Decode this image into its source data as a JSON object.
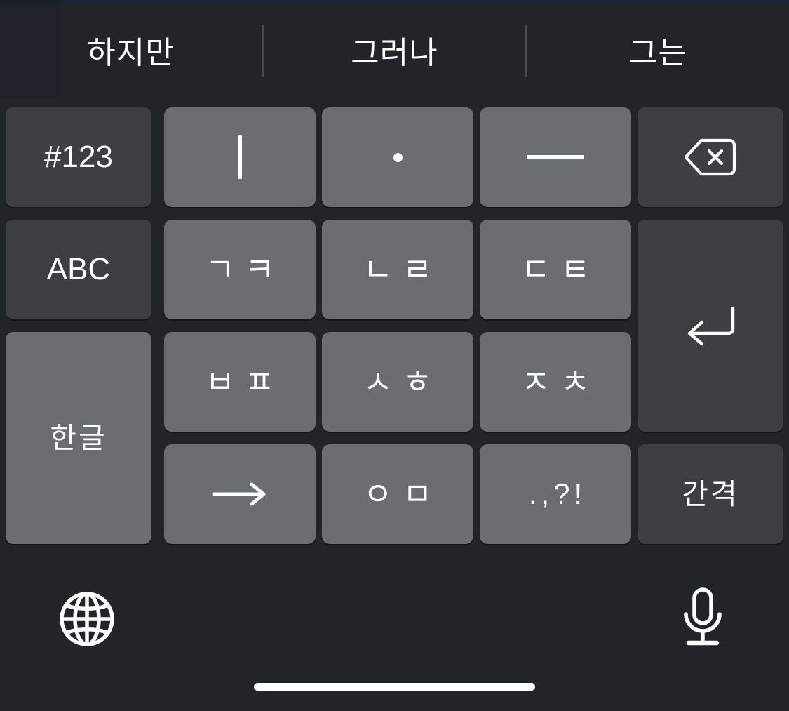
{
  "keyboard": {
    "language": "Korean",
    "layout_name": "cheonjiin",
    "colors": {
      "background": "#212429",
      "key_letter": "#6a6e72",
      "key_modifier": "#3d3f42",
      "key_text": "#ffffff",
      "divider": "#474c53",
      "status_strip": "#1b2230",
      "home_indicator": "#ffffff"
    }
  },
  "suggestions": {
    "items": [
      {
        "label": "하지만"
      },
      {
        "label": "그러나"
      },
      {
        "label": "그는"
      }
    ]
  },
  "keys": {
    "numbers_mode": {
      "label": "#123"
    },
    "vowel_i": {
      "label": "ㅣ",
      "glyph": "vertical-bar"
    },
    "vowel_dot": {
      "label": "ㆍ",
      "glyph": "dot"
    },
    "vowel_eu": {
      "label": "ㅡ",
      "glyph": "horizontal-dash"
    },
    "backspace": {
      "label": "",
      "icon": "backspace-icon"
    },
    "abc_mode": {
      "label": "ABC"
    },
    "giyeok_kieuk": {
      "label": "ㄱㅋ"
    },
    "nieun_rieul": {
      "label": "ㄴㄹ"
    },
    "digeut_tieut": {
      "label": "ㄷㅌ"
    },
    "return": {
      "label": "",
      "icon": "return-icon"
    },
    "hangul_mode": {
      "label": "한글",
      "state": "active"
    },
    "bieup_pieup": {
      "label": "ㅂㅍ"
    },
    "siot_hieut": {
      "label": "ㅅㅎ"
    },
    "jieut_chieut": {
      "label": "ㅈㅊ"
    },
    "next_char": {
      "label": "→",
      "icon": "arrow-right-icon"
    },
    "ieung_mieum": {
      "label": "ㅇㅁ"
    },
    "punctuation": {
      "label": ".,?!"
    },
    "space": {
      "label": "간격"
    }
  },
  "bottom_bar": {
    "globe": {
      "name": "globe-icon",
      "label": "언어 변경"
    },
    "mic": {
      "name": "microphone-icon",
      "label": "받아쓰기"
    }
  }
}
